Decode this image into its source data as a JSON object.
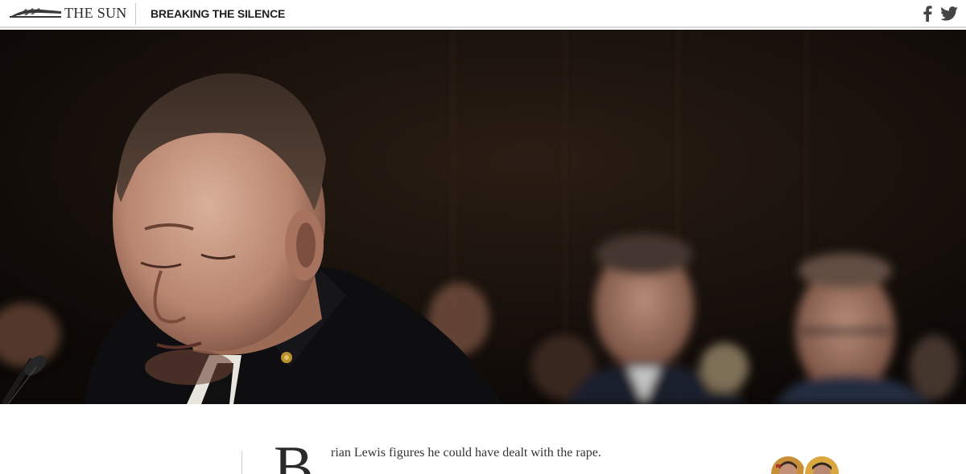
{
  "header": {
    "logo_text": "THE SUN",
    "section_title": "BREAKING THE SILENCE",
    "social": [
      {
        "icon": "facebook-icon",
        "label": "Share on Facebook"
      },
      {
        "icon": "twitter-icon",
        "label": "Share on Twitter"
      }
    ]
  },
  "hero": {
    "alt": "Brian Lewis testifying with eyes closed, uniformed officers seated in the background"
  },
  "article": {
    "dropcap": "B",
    "lede": "rian Lewis figures he could have dealt with the rape."
  },
  "colors": {
    "header_bg": "#ffffff",
    "text": "#2a2a2a",
    "hero_bg": "#120d09"
  }
}
